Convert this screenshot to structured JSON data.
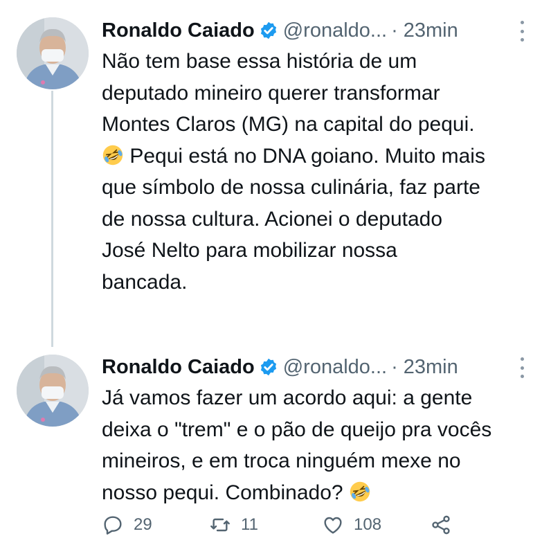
{
  "tweets": [
    {
      "author": "Ronaldo Caiado",
      "handle": "@ronaldo...",
      "separator": "·",
      "time": "23min",
      "text": "Não tem base essa história de um\ndeputado mineiro querer transformar\nMontes Claros (MG) na capital do pequi.\n",
      "text_after_emoji": " Pequi está no DNA goiano. Muito mais\nque símbolo de nossa culinária, faz parte\nde nossa cultura. Acionei o deputado\nJosé Nelto para mobilizar nossa\nbancada."
    },
    {
      "author": "Ronaldo Caiado",
      "handle": "@ronaldo...",
      "separator": "·",
      "time": "23min",
      "text": "Já vamos fazer um acordo aqui: a gente\ndeixa o \"trem\" e o pão de queijo pra vocês\nmineiros, e em troca ninguém mexe no\nnosso pequi. Combinado? ",
      "actions": {
        "replies": "29",
        "retweets": "11",
        "likes": "108"
      }
    }
  ],
  "colors": {
    "verified": "#1d9bf0",
    "muted": "#536471",
    "thread_line": "#cfd9de"
  },
  "icons": [
    "verified-badge-icon",
    "more-options-icon",
    "rolling-on-floor-laughing-emoji",
    "reply-icon",
    "retweet-icon",
    "like-icon",
    "share-icon"
  ]
}
